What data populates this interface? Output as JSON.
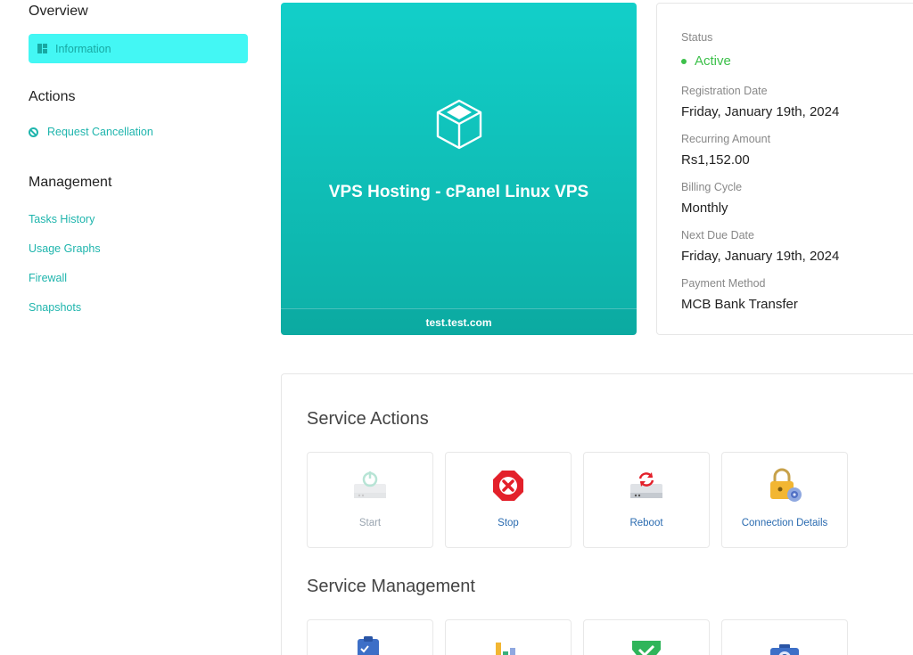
{
  "sidebar": {
    "overview_title": "Overview",
    "information_label": "Information",
    "actions_title": "Actions",
    "request_cancellation": "Request Cancellation",
    "management_title": "Management",
    "management_links": [
      "Tasks History",
      "Usage Graphs",
      "Firewall",
      "Snapshots"
    ]
  },
  "product": {
    "name": "VPS Hosting - cPanel Linux VPS",
    "domain": "test.test.com",
    "icon": "cube-icon"
  },
  "details": {
    "status_label": "Status",
    "status_value": "Active",
    "registration_label": "Registration Date",
    "registration_value": "Friday, January 19th, 2024",
    "recurring_label": "Recurring Amount",
    "recurring_value": "Rs1,152.00",
    "billing_label": "Billing Cycle",
    "billing_value": "Monthly",
    "nextdue_label": "Next Due Date",
    "nextdue_value": "Friday, January 19th, 2024",
    "payment_label": "Payment Method",
    "payment_value": "MCB Bank Transfer"
  },
  "service_actions": {
    "title": "Service Actions",
    "tiles": [
      {
        "label": "Start",
        "icon": "power-server-icon",
        "disabled": true
      },
      {
        "label": "Stop",
        "icon": "stop-sign-icon",
        "disabled": false
      },
      {
        "label": "Reboot",
        "icon": "reboot-server-icon",
        "disabled": false
      },
      {
        "label": "Connection Details",
        "icon": "lock-gear-icon",
        "disabled": false
      }
    ]
  },
  "service_management": {
    "title": "Service Management",
    "tiles": [
      {
        "icon": "clipboard-search-icon"
      },
      {
        "icon": "bar-graph-icon"
      },
      {
        "icon": "shield-icon"
      },
      {
        "icon": "camera-icon"
      }
    ]
  },
  "colors": {
    "accent": "#1fb5ad",
    "active": "#3cc04a",
    "card_top": "#12cfc9",
    "card_bottom": "#0db0a7",
    "link_blue": "#2a6bb0"
  }
}
